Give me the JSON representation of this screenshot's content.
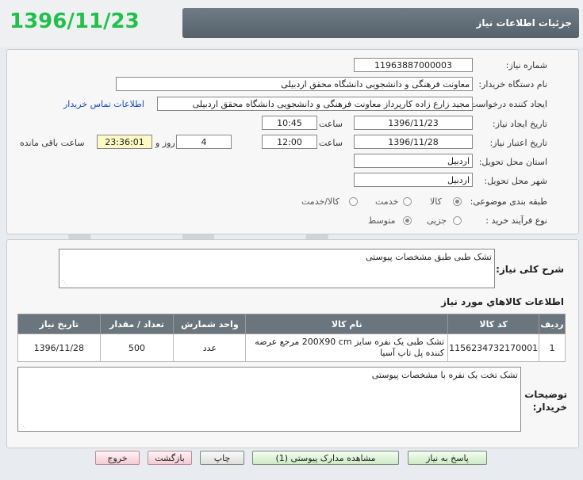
{
  "header": {
    "title": "جزئیات اطلاعات نیاز",
    "big_date": "1396/11/23"
  },
  "form": {
    "need_number": {
      "label": "شماره نیاز:",
      "value": "11963887000003"
    },
    "buyer_org": {
      "label": "نام دستگاه خریدار:",
      "value": "معاونت فرهنگی و دانشجویی دانشگاه محقق اردبیلی"
    },
    "requester": {
      "label": "ایجاد کننده درخواست:",
      "value": "مجید زارع زاده کارپرداز معاونت فرهنگی و دانشجویی دانشگاه محقق اردبیلی",
      "contact_link": "اطلاعات تماس خریدار"
    },
    "created": {
      "label": "تاریخ ایجاد نیاز:",
      "date": "1396/11/23",
      "time_label": "ساعت",
      "time": "10:45"
    },
    "validity": {
      "label": "تاریخ اعتبار نیاز:",
      "date": "1396/11/28",
      "time_label": "ساعت",
      "time": "12:00",
      "days": "4",
      "days_label": "روز و",
      "remaining": "23:36:01",
      "remaining_label": "ساعت باقی مانده"
    },
    "province": {
      "label": "استان محل تحویل:",
      "value": "اردبیل"
    },
    "city": {
      "label": "شهر محل تحویل:",
      "value": "اردبیل"
    },
    "category": {
      "label": "طبقه بندی موضوعی:",
      "options": [
        "کالا",
        "خدمت",
        "کالا/خدمت"
      ],
      "selected": "کالا"
    },
    "purchase_type": {
      "label": "نوع فرآیند خرید :",
      "options": [
        "جزیی",
        "متوسط"
      ],
      "selected": "متوسط"
    }
  },
  "description": {
    "label": "شرح کلی نیاز:",
    "value": "تشک طبی طبق مشخصات پیوستی"
  },
  "items_section": {
    "title": "اطلاعات کالاهاي مورد نياز",
    "columns": [
      "ردیف",
      "کد کالا",
      "نام کالا",
      "واحد شمارش",
      "تعداد / مقدار",
      "تاریخ نیاز"
    ],
    "rows": [
      {
        "row": "1",
        "code": "1156234732170001",
        "name": "تشک طبی یک نفره سایز 200X90 cm مرجع عرضه کننده پل تاپ آسیا",
        "unit": "عدد",
        "qty": "500",
        "date": "1396/11/28"
      }
    ]
  },
  "buyer_notes": {
    "label": "توضیحات خریدار:",
    "value": "تشک تخت یک نفره با مشخصات پیوستی"
  },
  "buttons": {
    "reply": "پاسخ به نیاز",
    "attachments": "مشاهده مدارک پیوستی (1)",
    "print": "چاپ",
    "back": "بازگشت",
    "exit": "خروج"
  },
  "colors": {
    "header_bar": "#5f6b74",
    "big_date": "#21c04a",
    "link": "#1a49c9",
    "table_header": "#6a757d",
    "highlight": "#fff9c4"
  }
}
